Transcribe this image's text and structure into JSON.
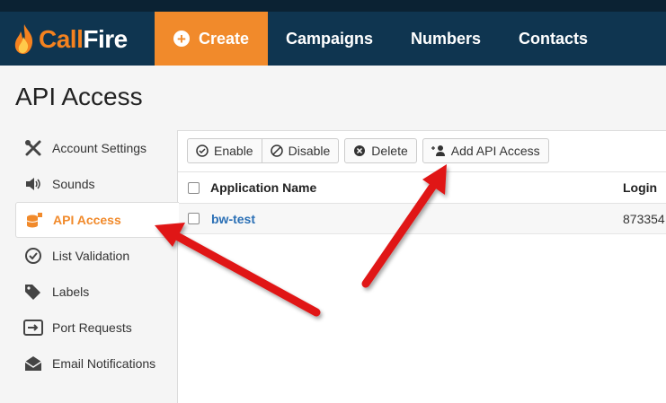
{
  "brand": {
    "name_part1": "Call",
    "name_part2": "Fire"
  },
  "nav": {
    "create_label": "Create",
    "campaigns_label": "Campaigns",
    "numbers_label": "Numbers",
    "contacts_label": "Contacts"
  },
  "page": {
    "title": "API Access"
  },
  "sidebar": {
    "items": [
      {
        "label": "Account Settings",
        "icon": "tools-icon"
      },
      {
        "label": "Sounds",
        "icon": "speaker-icon"
      },
      {
        "label": "API Access",
        "icon": "database-lock-icon",
        "active": true
      },
      {
        "label": "List Validation",
        "icon": "check-circle-icon"
      },
      {
        "label": "Labels",
        "icon": "tags-icon"
      },
      {
        "label": "Port Requests",
        "icon": "port-icon"
      },
      {
        "label": "Email Notifications",
        "icon": "envelope-icon"
      }
    ]
  },
  "toolbar": {
    "enable_label": "Enable",
    "disable_label": "Disable",
    "delete_label": "Delete",
    "add_label": "Add API Access"
  },
  "table": {
    "columns": [
      "Application Name",
      "Login"
    ],
    "rows": [
      {
        "name": "bw-test",
        "login": "873354"
      }
    ]
  },
  "colors": {
    "nav_bg": "#0f3550",
    "accent": "#f18a2b",
    "link": "#2a6fb5",
    "arrow": "#e01818"
  }
}
